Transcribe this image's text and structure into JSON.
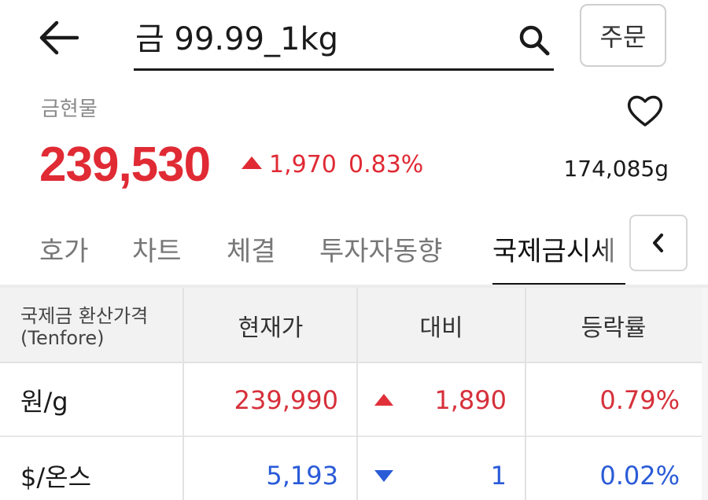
{
  "header": {
    "search_value": "금 99.99_1kg",
    "order_label": "주문"
  },
  "quote": {
    "category": "금현물",
    "price": "239,530",
    "change_value": "1,970",
    "change_percent": "0.83%",
    "volume": "174,085g",
    "direction": "up"
  },
  "tabs": [
    {
      "label": "호가",
      "active": false
    },
    {
      "label": "차트",
      "active": false
    },
    {
      "label": "체결",
      "active": false
    },
    {
      "label": "투자자동향",
      "active": false
    },
    {
      "label": "국제금시세",
      "active": true
    }
  ],
  "table": {
    "headers": {
      "col1_line1": "국제금 환산가격",
      "col1_line2": "(Tenfore)",
      "col2": "현재가",
      "col3": "대비",
      "col4": "등락률"
    },
    "rows": [
      {
        "label": "원/g",
        "price": "239,990",
        "change": "1,890",
        "rate": "0.79%",
        "direction": "up"
      },
      {
        "label": "$/온스",
        "price": "5,193",
        "change": "1",
        "rate": "0.02%",
        "direction": "down"
      }
    ]
  },
  "colors": {
    "up": "#e02a34",
    "down": "#2a5bd7"
  },
  "icons": [
    "back-arrow-icon",
    "search-icon",
    "heart-icon",
    "chevron-left-icon"
  ]
}
